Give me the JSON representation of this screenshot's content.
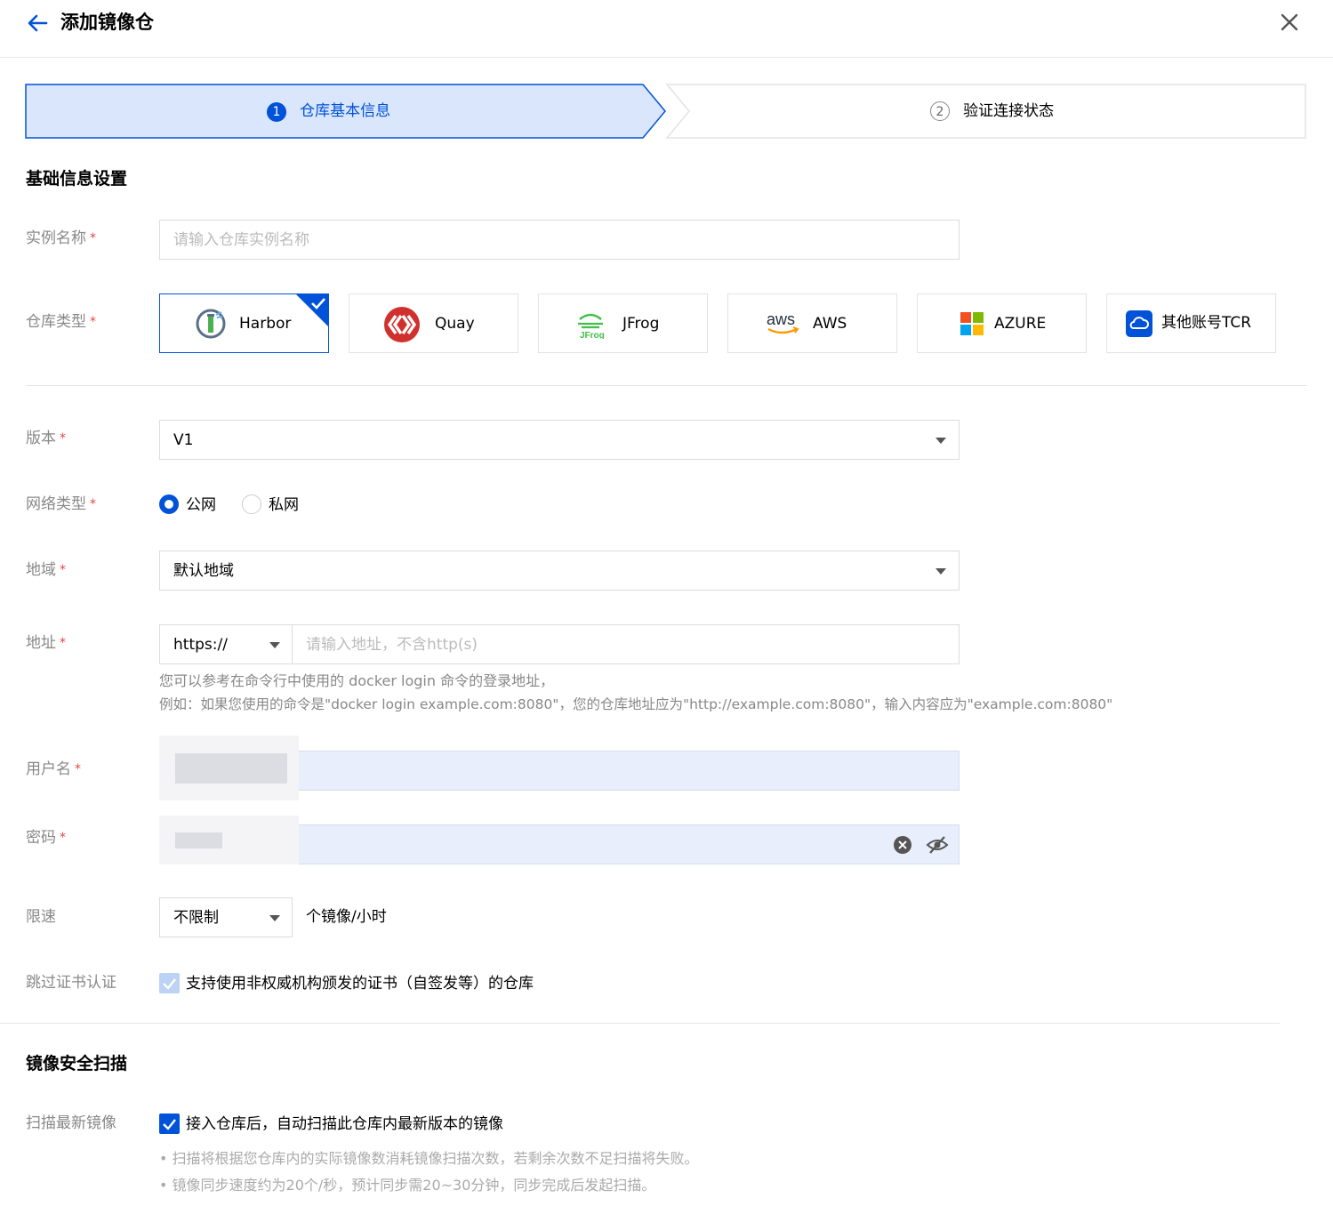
{
  "header": {
    "title": "添加镜像仓"
  },
  "steps": [
    {
      "num": "1",
      "label": "仓库基本信息"
    },
    {
      "num": "2",
      "label": "验证连接状态"
    }
  ],
  "basic": {
    "title": "基础信息设置",
    "instance_name": {
      "label": "实例名称",
      "placeholder": "请输入仓库实例名称"
    },
    "registry_type": {
      "label": "仓库类型",
      "options": [
        "Harbor",
        "Quay",
        "JFrog",
        "AWS",
        "AZURE",
        "其他账号TCR"
      ],
      "selected": "Harbor"
    },
    "version": {
      "label": "版本",
      "value": "V1"
    },
    "network": {
      "label": "网络类型",
      "options": [
        "公网",
        "私网"
      ],
      "selected": "公网"
    },
    "region": {
      "label": "地域",
      "value": "默认地域"
    },
    "address": {
      "label": "地址",
      "protocol": "https://",
      "placeholder": "请输入地址，不含http(s)",
      "help_line1": "您可以参考在命令行中使用的 docker login 命令的登录地址，",
      "help_line2": "例如：如果您使用的命令是\"docker login example.com:8080\"，您的仓库地址应为\"http://example.com:8080\"，输入内容应为\"example.com:8080\""
    },
    "username": {
      "label": "用户名"
    },
    "password": {
      "label": "密码"
    },
    "rate_limit": {
      "label": "限速",
      "value": "不限制",
      "unit": "个镜像/小时"
    },
    "skip_cert": {
      "label": "跳过证书认证",
      "text": "支持使用非权威机构颁发的证书（自签发等）的仓库",
      "checked": true
    }
  },
  "scan": {
    "title": "镜像安全扫描",
    "latest": {
      "label": "扫描最新镜像",
      "text": "接入仓库后，自动扫描此仓库内最新版本的镜像",
      "checked": true
    },
    "notes": [
      "扫描将根据您仓库内的实际镜像数消耗镜像扫描次数，若剩余次数不足扫描将失败。",
      "镜像同步速度约为20个/秒，预计同步需20~30分钟，同步完成后发起扫描。"
    ]
  },
  "colors": {
    "primary": "#0052d9",
    "required": "#e54545",
    "step_active_bg": "#d9e6fb",
    "filled_bg": "#e8eefb"
  },
  "icons": [
    "back-arrow-icon",
    "close-icon",
    "harbor-logo-icon",
    "quay-logo-icon",
    "jfrog-logo-icon",
    "aws-logo-icon",
    "azure-logo-icon",
    "tcr-logo-icon",
    "clear-icon",
    "eye-off-icon",
    "check-icon",
    "chevron-down-icon"
  ]
}
